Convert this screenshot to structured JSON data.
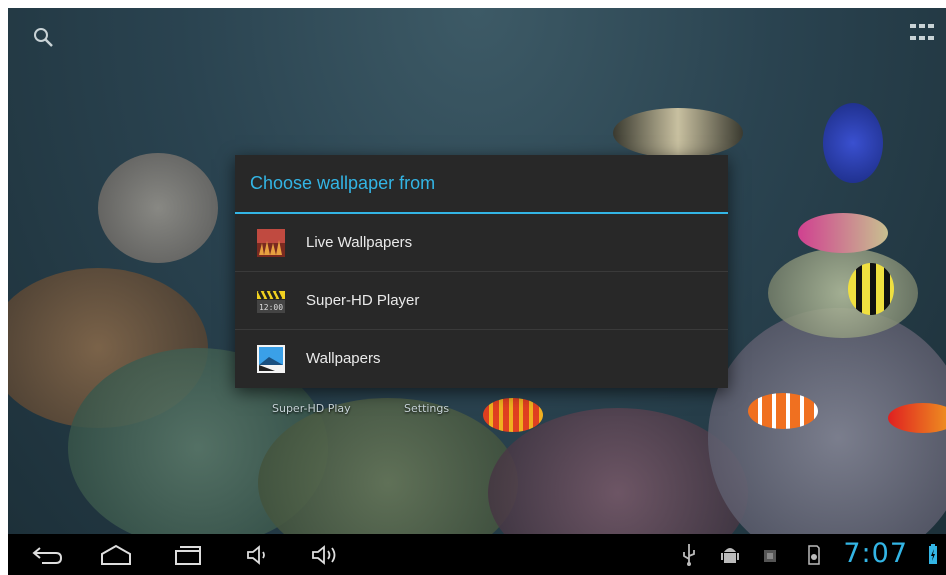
{
  "dialog": {
    "title": "Choose wallpaper from",
    "items": [
      {
        "label": "Live Wallpapers",
        "icon": "live-wallpapers-icon"
      },
      {
        "label": "Super-HD Player",
        "icon": "super-hd-player-icon"
      },
      {
        "label": "Wallpapers",
        "icon": "wallpapers-icon"
      }
    ]
  },
  "workspace": {
    "shortcuts": [
      {
        "label": "Super-HD Play"
      },
      {
        "label": "Settings"
      }
    ]
  },
  "status_bar": {
    "time": "7:07"
  },
  "colors": {
    "accent": "#33b5e5",
    "dialog_bg": "#282828",
    "nav_bg": "#000000"
  }
}
